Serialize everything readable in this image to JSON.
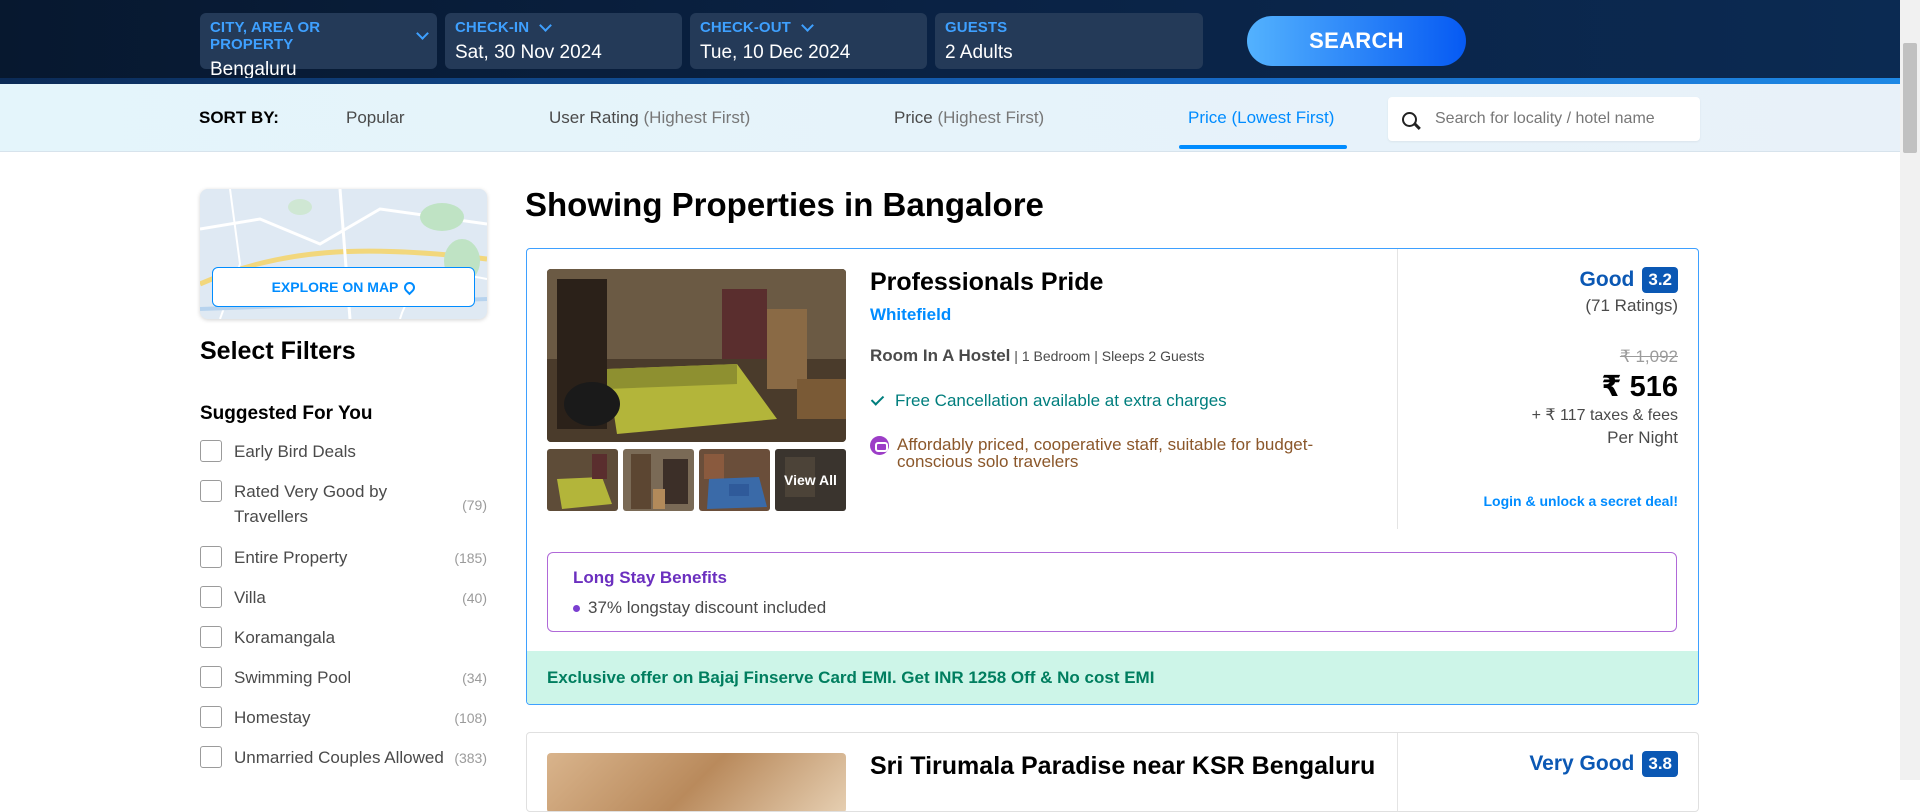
{
  "search": {
    "city": {
      "label": "CITY, AREA OR PROPERTY",
      "value": "Bengaluru"
    },
    "checkin": {
      "label": "CHECK-IN",
      "value": "Sat, 30 Nov 2024"
    },
    "checkout": {
      "label": "CHECK-OUT",
      "value": "Tue, 10 Dec 2024"
    },
    "guests": {
      "label": "GUESTS",
      "value": "2 Adults"
    },
    "button": "SEARCH"
  },
  "sort": {
    "label": "SORT BY:",
    "options": [
      {
        "main": "Popular",
        "sub": ""
      },
      {
        "main": "User Rating",
        "sub": "(Highest First)"
      },
      {
        "main": "Price",
        "sub": "(Highest First)"
      },
      {
        "main": "Price",
        "sub": "(Lowest First)"
      }
    ],
    "active_index": 3,
    "locality_placeholder": "Search for locality / hotel name"
  },
  "sidebar": {
    "explore_map": "EXPLORE ON MAP",
    "select_filters": "Select Filters",
    "suggested_title": "Suggested For You",
    "filters": [
      {
        "label": "Early Bird Deals",
        "count": ""
      },
      {
        "label": "Rated Very Good by Travellers",
        "count": "(79)"
      },
      {
        "label": "Entire Property",
        "count": "(185)"
      },
      {
        "label": "Villa",
        "count": "(40)"
      },
      {
        "label": "Koramangala",
        "count": ""
      },
      {
        "label": "Swimming Pool",
        "count": "(34)"
      },
      {
        "label": "Homestay",
        "count": "(108)"
      },
      {
        "label": "Unmarried Couples Allowed",
        "count": "(383)"
      }
    ]
  },
  "results": {
    "title": "Showing Properties in Bangalore",
    "hotels": [
      {
        "name": "Professionals Pride",
        "location": "Whitefield",
        "room_type": "Room In A Hostel",
        "room_meta": " | 1 Bedroom | Sleeps 2 Guests",
        "free_cancellation": "Free Cancellation available at extra charges",
        "review_summary": "Affordably priced, cooperative staff, suitable for budget-conscious solo travelers",
        "view_all": "View All",
        "rating_word": "Good",
        "rating_score": "3.2",
        "rating_count": "(71 Ratings)",
        "price_old": "₹ 1,092",
        "price_new": "₹ 516",
        "taxes": "+ ₹ 117 taxes & fees",
        "per_night": "Per Night",
        "login_deal": "Login & unlock a secret deal!",
        "long_stay_title": "Long Stay Benefits",
        "long_stay_item": "37% longstay discount included",
        "offer": "Exclusive offer on Bajaj Finserve Card EMI. Get INR 1258 Off & No cost EMI"
      },
      {
        "name": "Sri Tirumala Paradise near KSR Bengaluru",
        "rating_word": "Very Good",
        "rating_score": "3.8"
      }
    ]
  },
  "colors": {
    "accent_blue": "#008cff",
    "rating_blue": "#0b58b4",
    "header_navy": "#0a2244",
    "offer_green_bg": "#cdf5e8",
    "longstay_purple": "#b069d8"
  },
  "icons": {
    "dropdown": "chevron-down-icon",
    "search": "search-icon",
    "map_pin": "map-pin-icon",
    "check": "check-icon",
    "review": "review-summary-icon"
  }
}
